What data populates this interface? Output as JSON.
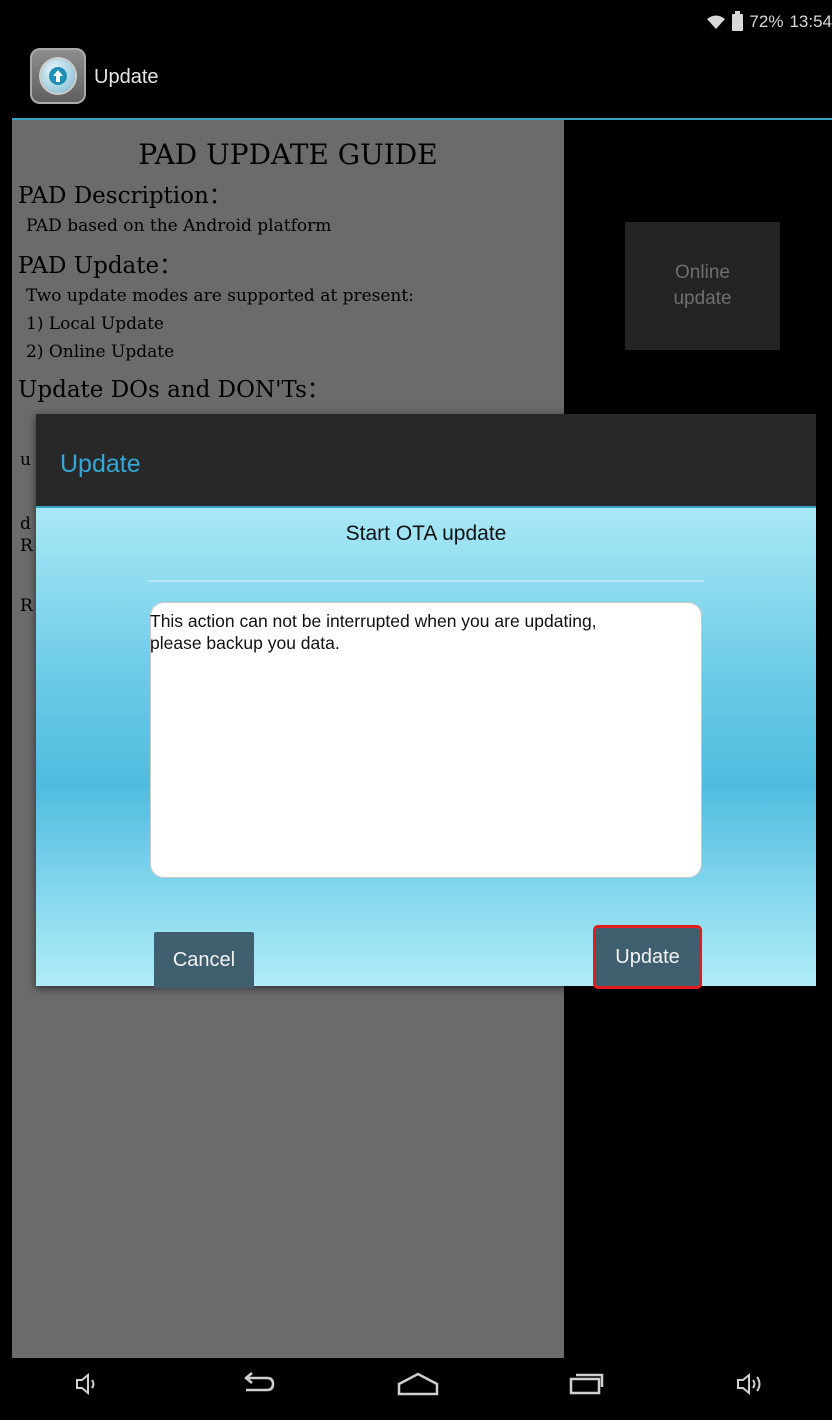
{
  "status_bar": {
    "battery_percent": "72%",
    "time": "13:54",
    "icons": [
      "wifi-icon",
      "battery-icon"
    ]
  },
  "action_bar": {
    "title": "Update",
    "icon": "app-update-icon"
  },
  "guide": {
    "title": "PAD UPDATE GUIDE",
    "description_heading": "PAD Description：",
    "description_text": "PAD based on the Android platform",
    "update_heading": "PAD Update：",
    "update_lines": [
      "Two update modes are supported at present:",
      "1) Local Update",
      "2) Online Update"
    ],
    "dos_heading": "Update DOs and DON'Ts：",
    "hidden_fragments": [
      "u",
      "d",
      "R",
      "R"
    ]
  },
  "online_update_button": "Online update",
  "dialog": {
    "title": "Update",
    "subtitle": "Start OTA update",
    "message": "This action can not be interrupted when you are updating, please backup you data.",
    "cancel_label": "Cancel",
    "update_label": "Update"
  },
  "nav_bar": {
    "icons": [
      "volume-down-icon",
      "back-icon",
      "home-icon",
      "recents-icon",
      "volume-up-icon"
    ]
  },
  "colors": {
    "accent": "#35a3c6",
    "dialog_title": "#35a7d6",
    "button_bg": "#3f5f6e",
    "highlight": "#e01c1c"
  }
}
